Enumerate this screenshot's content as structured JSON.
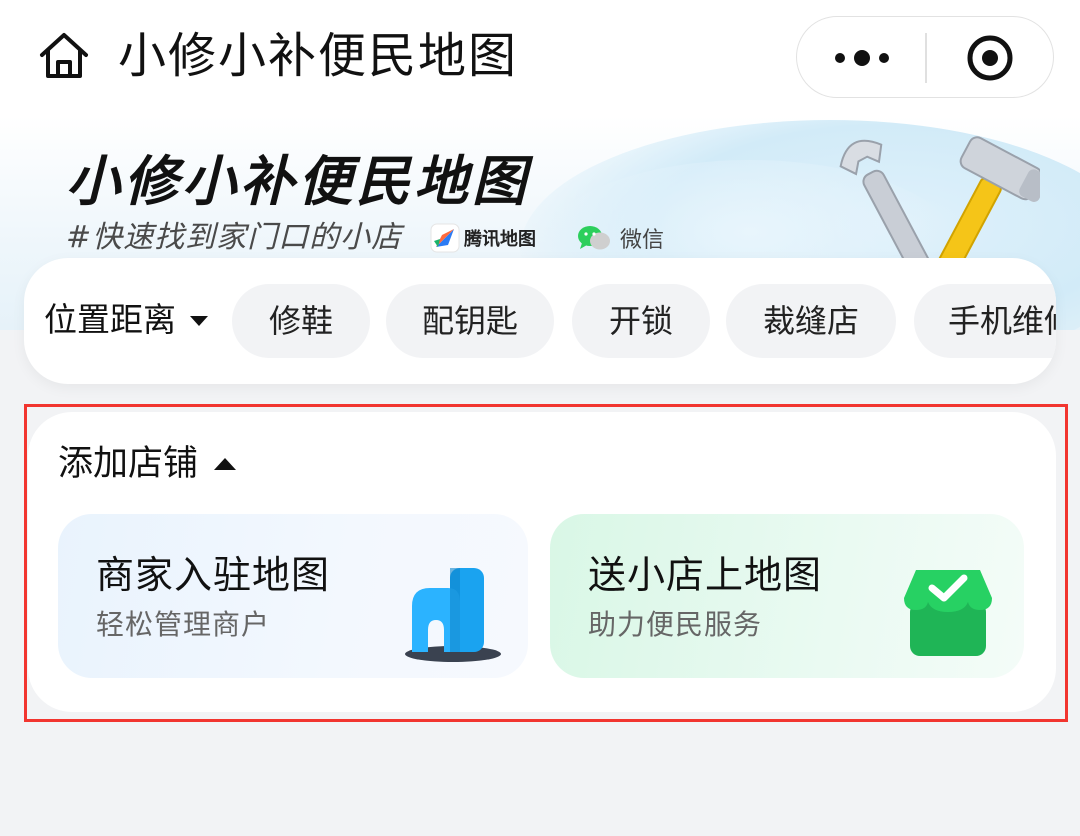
{
  "navbar": {
    "title": "小修小补便民地图"
  },
  "hero": {
    "title": "小修小补便民地图",
    "subtitle": "#快速找到家门口的小店",
    "partner_tencent": "腾讯地图",
    "partner_wechat": "微信"
  },
  "filters": {
    "sort_label": "位置距离",
    "chips": [
      "修鞋",
      "配钥匙",
      "开锁",
      "裁缝店",
      "手机维修"
    ]
  },
  "add_store": {
    "title": "添加店铺",
    "merchant": {
      "title": "商家入驻地图",
      "subtitle": "轻松管理商户"
    },
    "submit": {
      "title": "送小店上地图",
      "subtitle": "助力便民服务"
    }
  },
  "colors": {
    "highlight_frame": "#f2352f",
    "wechat_green": "#2ccf5c",
    "store_green": "#22c55e",
    "building_blue": "#1aa3f0"
  }
}
